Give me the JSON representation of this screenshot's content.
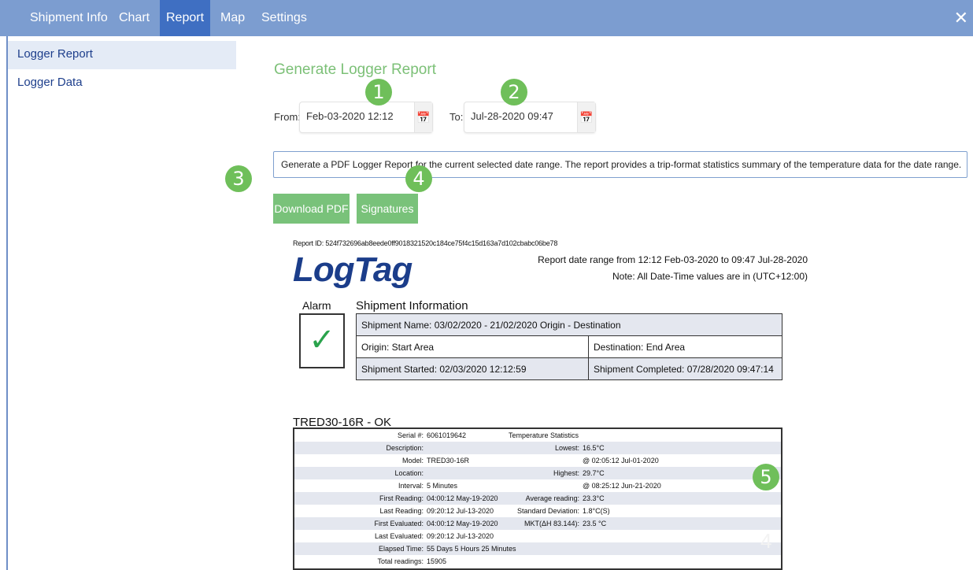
{
  "tabs": [
    "Shipment Info",
    "Chart",
    "Report",
    "Map",
    "Settings"
  ],
  "close_glyph": "✕",
  "sidebar": {
    "items": [
      "Logger Report",
      "Logger Data"
    ]
  },
  "main": {
    "title": "Generate Logger Report",
    "from_label": "From:",
    "from_value": "Feb-03-2020 12:12",
    "to_label": "To:",
    "to_value": "Jul-28-2020 09:47",
    "description": "Generate a PDF Logger Report for the current selected date range. The report provides a trip-format statistics summary of the temperature data for the date range.",
    "download_label": "Download PDF",
    "signatures_label": "Signatures"
  },
  "badges": [
    "1",
    "2",
    "3",
    "4",
    "5"
  ],
  "icons": {
    "calendar": "calendar-icon",
    "check": "check-icon",
    "close": "close-icon"
  },
  "report": {
    "report_id": "Report ID: 524f732696ab8eede0ff9018321520c184ce75f4c15d163a7d102cbabc06be78",
    "logo": "LogTag",
    "range_line": "Report date range from 12:12 Feb-03-2020 to 09:47 Jul-28-2020",
    "note_line": "Note: All Date-Time values are in (UTC+12:00)",
    "alarm_label": "Alarm",
    "check_glyph": "✓",
    "shipment_info_title": "Shipment Information",
    "shipment_name": "Shipment Name: 03/02/2020 - 21/02/2020 Origin - Destination",
    "origin": "Origin: Start Area",
    "destination": "Destination: End Area",
    "started": "Shipment Started: 02/03/2020 12:12:59",
    "completed": "Shipment Completed: 07/28/2020 09:47:14",
    "device_title": "TRED30-16R - OK",
    "device_rows": [
      {
        "k1": "Serial #:",
        "v1": "6061019642",
        "k2": "",
        "v2": "",
        "full": "Temperature Statistics"
      },
      {
        "k1": "Description:",
        "v1": "",
        "k2": "Lowest:",
        "v2": "16.5°C",
        "full": ""
      },
      {
        "k1": "Model:",
        "v1": "TRED30-16R",
        "k2": "",
        "v2": "@ 02:05:12 Jul-01-2020",
        "full": ""
      },
      {
        "k1": "Location:",
        "v1": "",
        "k2": "Highest:",
        "v2": "29.7°C",
        "full": ""
      },
      {
        "k1": "Interval:",
        "v1": "5 Minutes",
        "k2": "",
        "v2": "@ 08:25:12 Jun-21-2020",
        "full": ""
      },
      {
        "k1": "First Reading:",
        "v1": "04:00:12 May-19-2020",
        "k2": "Average reading:",
        "v2": "23.3°C",
        "full": ""
      },
      {
        "k1": "Last Reading:",
        "v1": "09:20:12 Jul-13-2020",
        "k2": "Standard Deviation:",
        "v2": "1.8°C(S)",
        "full": ""
      },
      {
        "k1": "First Evaluated:",
        "v1": "04:00:12 May-19-2020",
        "k2": "MKT(ΔH 83.144):",
        "v2": "23.5 °C",
        "full": ""
      },
      {
        "k1": "Last Evaluated:",
        "v1": "09:20:12 Jul-13-2020",
        "k2": "",
        "v2": "",
        "full": ""
      },
      {
        "k1": "Elapsed Time:",
        "v1": "55 Days 5 Hours 25 Minutes",
        "k2": "",
        "v2": "",
        "full": ""
      },
      {
        "k1": "Total readings:",
        "v1": "15905",
        "k2": "",
        "v2": "",
        "full": ""
      }
    ],
    "watermark": "4"
  }
}
